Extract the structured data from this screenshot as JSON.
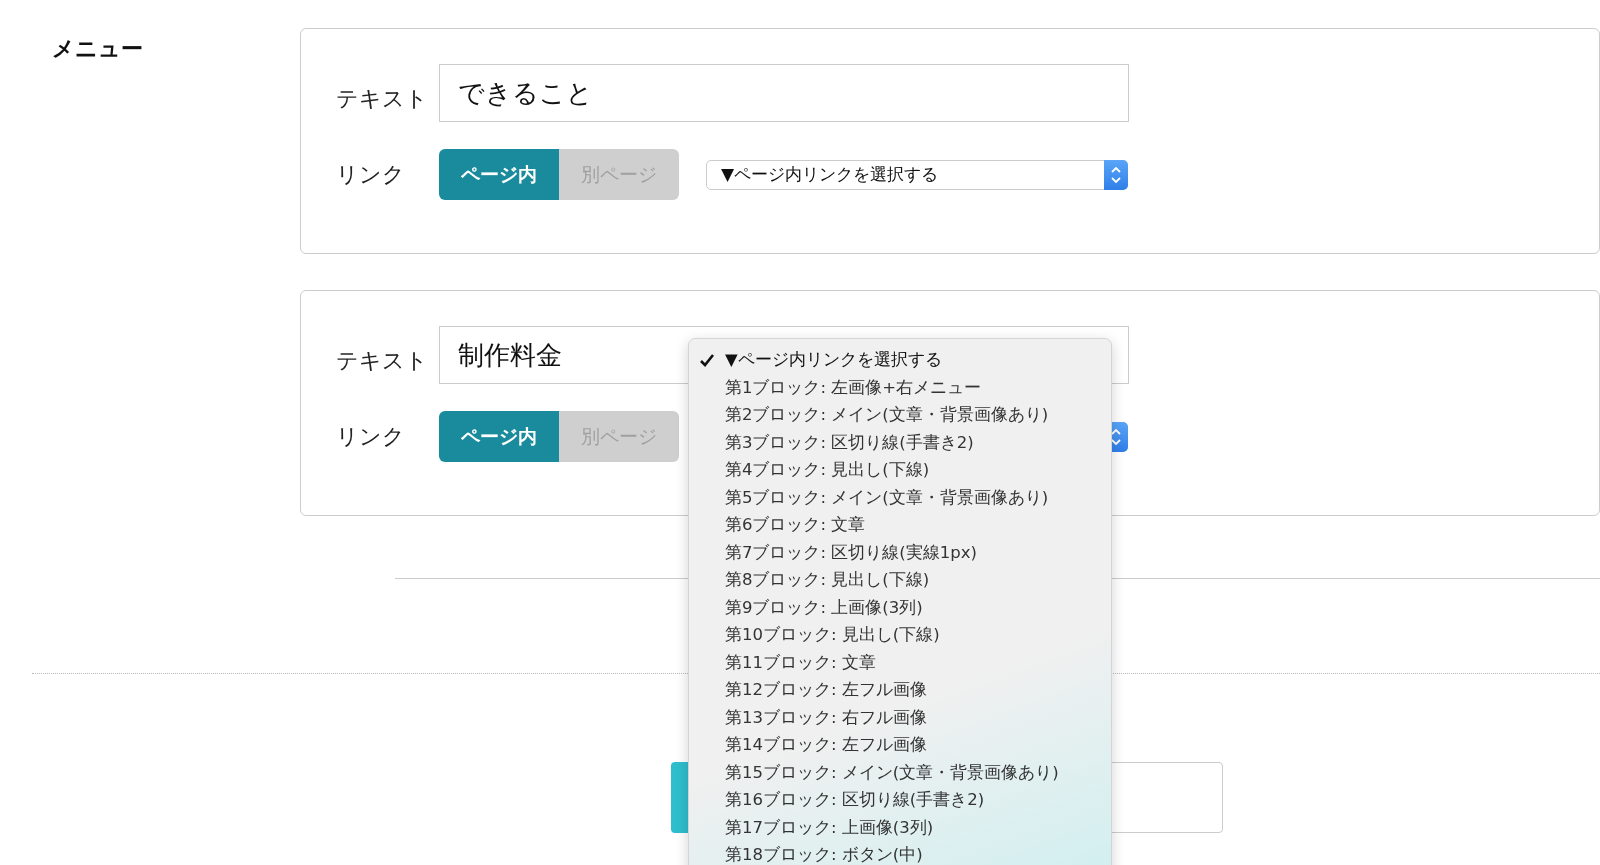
{
  "section_title": "メニュー",
  "menu_items": [
    {
      "text_label": "テキスト",
      "text_value": "できること",
      "link_label": "リンク",
      "link_types": [
        {
          "label": "ページ内",
          "selected": true
        },
        {
          "label": "別ページ",
          "selected": false
        }
      ],
      "anchor_select": {
        "open": false,
        "value": "▼ページ内リンクを選択する"
      }
    },
    {
      "text_label": "テキスト",
      "text_value": "制作料金",
      "link_label": "リンク",
      "link_types": [
        {
          "label": "ページ内",
          "selected": true
        },
        {
          "label": "別ページ",
          "selected": false
        }
      ],
      "anchor_select": {
        "open": true,
        "options": [
          {
            "label": "▼ページ内リンクを選択する",
            "selected": true
          },
          {
            "label": "第1ブロック: 左画像+右メニュー",
            "selected": false
          },
          {
            "label": "第2ブロック: メイン(文章・背景画像あり)",
            "selected": false
          },
          {
            "label": "第3ブロック: 区切り線(手書き2)",
            "selected": false
          },
          {
            "label": "第4ブロック: 見出し(下線)",
            "selected": false
          },
          {
            "label": "第5ブロック: メイン(文章・背景画像あり)",
            "selected": false
          },
          {
            "label": "第6ブロック: 文章",
            "selected": false
          },
          {
            "label": "第7ブロック: 区切り線(実線1px)",
            "selected": false
          },
          {
            "label": "第8ブロック: 見出し(下線)",
            "selected": false
          },
          {
            "label": "第9ブロック: 上画像(3列)",
            "selected": false
          },
          {
            "label": "第10ブロック: 見出し(下線)",
            "selected": false
          },
          {
            "label": "第11ブロック: 文章",
            "selected": false
          },
          {
            "label": "第12ブロック: 左フル画像",
            "selected": false
          },
          {
            "label": "第13ブロック: 右フル画像",
            "selected": false
          },
          {
            "label": "第14ブロック: 左フル画像",
            "selected": false
          },
          {
            "label": "第15ブロック: メイン(文章・背景画像あり)",
            "selected": false
          },
          {
            "label": "第16ブロック: 区切り線(手書き2)",
            "selected": false
          },
          {
            "label": "第17ブロック: 上画像(3列)",
            "selected": false
          },
          {
            "label": "第18ブロック: ボタン(中)",
            "selected": false
          }
        ]
      }
    }
  ],
  "bottom_buttons": [
    {
      "kind": "primary"
    },
    {
      "kind": "secondary"
    }
  ]
}
